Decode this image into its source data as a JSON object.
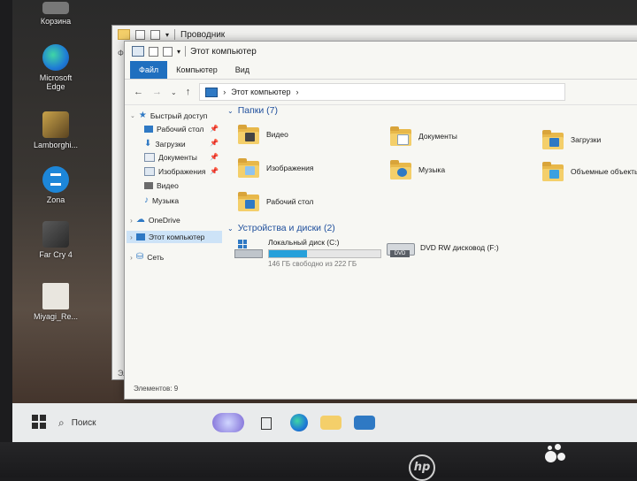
{
  "desktop": {
    "icons": [
      {
        "label": "Корзина",
        "icon": "recycle-bin-icon"
      },
      {
        "label": "Microsoft Edge",
        "icon": "edge-icon"
      },
      {
        "label": "Lamborghi...",
        "icon": "game-icon"
      },
      {
        "label": "Zona",
        "icon": "zona-icon"
      },
      {
        "label": "Far Cry 4",
        "icon": "game-icon"
      },
      {
        "label": "Miyagi_Re...",
        "icon": "file-icon"
      }
    ]
  },
  "back_window": {
    "title": "Проводник",
    "side_labels": [
      "Ф",
      "Эл"
    ]
  },
  "window": {
    "title": "Этот компьютер",
    "ribbon_tabs": [
      "Файл",
      "Компьютер",
      "Вид"
    ],
    "address": "Этот компьютер",
    "nav": {
      "quick_access": "Быстрый доступ",
      "quick_items": [
        "Рабочий стол",
        "Загрузки",
        "Документы",
        "Изображения",
        "Видео",
        "Музыка"
      ],
      "onedrive": "OneDrive",
      "this_pc": "Этот компьютер",
      "network": "Сеть"
    },
    "folders_header": "Папки (7)",
    "folders": [
      "Видео",
      "Документы",
      "Загрузки",
      "Изображения",
      "Музыка",
      "Объемные объекты",
      "Рабочий стол"
    ],
    "devices_header": "Устройства и диски (2)",
    "local_disk": {
      "name": "Локальный диск (C:)",
      "free_text": "146 ГБ свободно из 222 ГБ",
      "used_fraction": 0.34
    },
    "dvd": {
      "name": "DVD RW дисковод (F:)",
      "badge": "DVD"
    },
    "status": "Элементов: 9"
  },
  "taskbar": {
    "search_placeholder": "Поиск"
  },
  "colors": {
    "accent": "#1f6fbf",
    "folder": "#f4cf6a",
    "progress": "#26a0da"
  }
}
